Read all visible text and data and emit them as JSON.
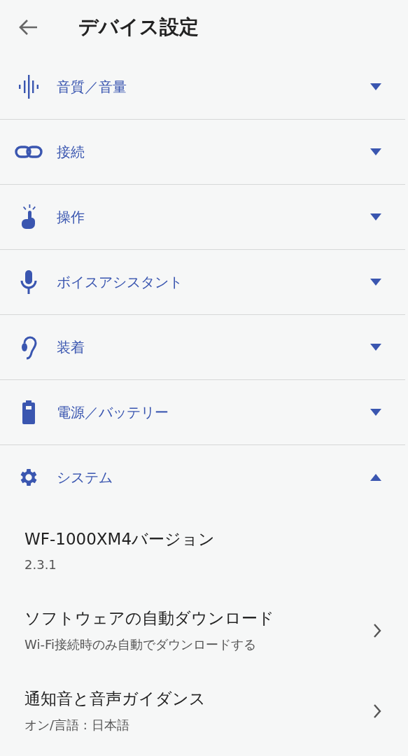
{
  "header": {
    "title": "デバイス設定"
  },
  "sections": [
    {
      "kind": "sound",
      "label": "音質／音量",
      "expanded": false
    },
    {
      "kind": "link",
      "label": "接続",
      "expanded": false
    },
    {
      "kind": "touch",
      "label": "操作",
      "expanded": false
    },
    {
      "kind": "mic",
      "label": "ボイスアシスタント",
      "expanded": false
    },
    {
      "kind": "ear",
      "label": "装着",
      "expanded": false
    },
    {
      "kind": "battery",
      "label": "電源／バッテリー",
      "expanded": false
    },
    {
      "kind": "gear",
      "label": "システム",
      "expanded": true,
      "items": [
        {
          "kind": "info",
          "title": "WF-1000XM4バージョン",
          "detail": "2.3.1"
        },
        {
          "kind": "link",
          "title": "ソフトウェアの自動ダウンロード",
          "detail": "Wi-Fi接続時のみ自動でダウンロードする"
        },
        {
          "kind": "link",
          "title": "通知音と音声ガイダンス",
          "detail": "オン/言語 : 日本語"
        }
      ]
    }
  ]
}
